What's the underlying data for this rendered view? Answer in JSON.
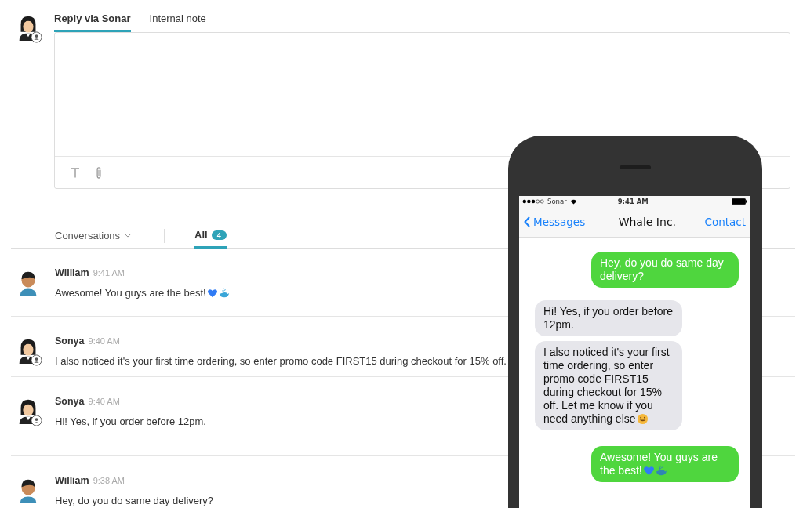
{
  "composer": {
    "avatar": {
      "agent": true
    },
    "tabs": [
      {
        "label": "Reply via Sonar",
        "selected": true
      },
      {
        "label": "Internal note",
        "selected": false
      }
    ]
  },
  "filter": {
    "dropdown": "Conversations",
    "tabs": [
      {
        "label": "All",
        "count": "4",
        "selected": true
      }
    ]
  },
  "conversations": [
    {
      "name": "William",
      "time": "9:41 AM",
      "text": "Awesome! You guys are the best!",
      "agent": false,
      "heart": true,
      "whale": true
    },
    {
      "name": "Sonya",
      "time": "9:40 AM",
      "text": "I also noticed it's your first time ordering, so enter promo code FIRST15 during checkout for 15% off.",
      "agent": true
    },
    {
      "name": "Sonya",
      "time": "9:40 AM",
      "text": "Hi! Yes, if you order before 12pm.",
      "agent": true
    },
    {
      "name": "William",
      "time": "9:38 AM",
      "text": "Hey, do you do same day delivery?",
      "agent": false
    }
  ],
  "phone": {
    "status": {
      "carrier": "Sonar",
      "time": "9:41 AM"
    },
    "nav": {
      "back": "Messages",
      "title": "Whale Inc.",
      "action": "Contact"
    },
    "messages": [
      {
        "kind": "sent",
        "text": "Hey, do you do same day delivery?"
      },
      {
        "kind": "received",
        "text": "Hi! Yes, if you order before 12pm."
      },
      {
        "kind": "received",
        "text": "I also noticed it's your first time ordering, so enter promo code FIRST15 during checkout for 15% off. Let me know if you need anything else",
        "smiley": true
      },
      {
        "kind": "sent",
        "text": "Awesome! You guys are the best!",
        "heart": true,
        "whale": true
      }
    ]
  }
}
